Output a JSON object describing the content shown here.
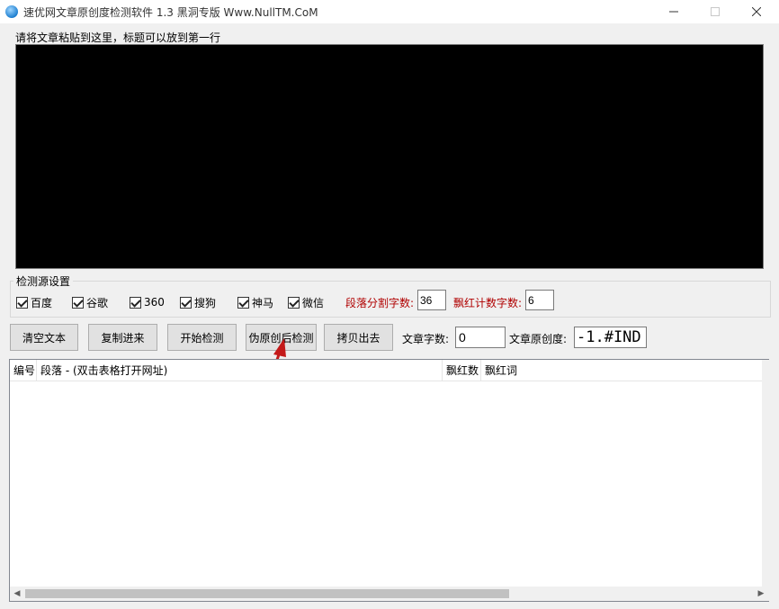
{
  "window": {
    "title": "速优网文章原创度检测软件 1.3    黑洞专版 Www.NullTM.CoM",
    "minimize_icon": "minimize-icon",
    "maximize_icon": "maximize-icon",
    "close_icon": "close-icon"
  },
  "editor": {
    "label": "请将文章粘贴到这里，标题可以放到第一行",
    "value": ""
  },
  "sources": {
    "group_label": "检测源设置",
    "items": [
      {
        "label": "百度",
        "checked": true
      },
      {
        "label": "谷歌",
        "checked": true
      },
      {
        "label": "360",
        "checked": true
      },
      {
        "label": "搜狗",
        "checked": true
      },
      {
        "label": "神马",
        "checked": true
      },
      {
        "label": "微信",
        "checked": true
      }
    ],
    "split_label": "段落分割字数:",
    "split_value": "36",
    "red_label": "飘红计数字数:",
    "red_value": "6"
  },
  "toolbar": {
    "clear_label": "清空文本",
    "copy_in_label": "复制进来",
    "start_label": "开始检测",
    "pseudo_label": "伪原创后检测",
    "copy_out_label": "拷贝出去",
    "word_count_label": "文章字数:",
    "word_count_value": "0",
    "originality_label": "文章原创度:",
    "originality_value": "-1.#IND"
  },
  "table": {
    "columns": [
      "编号",
      "段落 - (双击表格打开网址)",
      "飘红数",
      "飘红词"
    ],
    "rows": []
  },
  "colors": {
    "accent_red": "#b00000",
    "editor_bg": "#000000",
    "window_bg": "#f0f0f0"
  }
}
